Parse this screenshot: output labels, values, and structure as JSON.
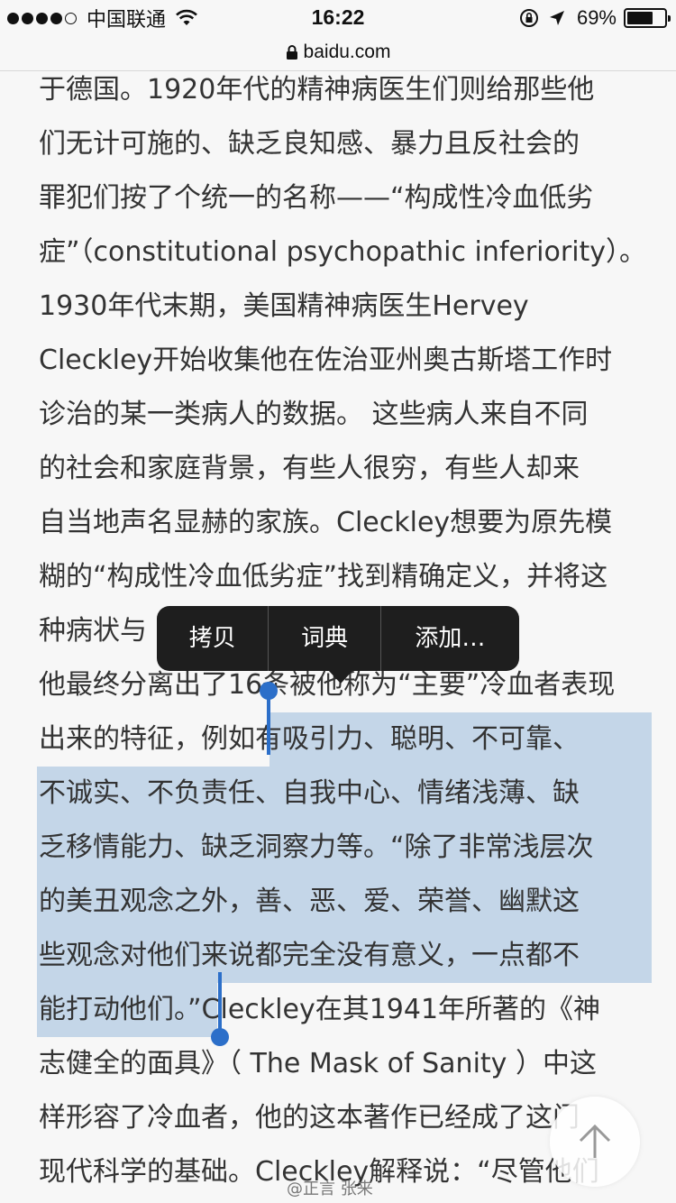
{
  "status_bar": {
    "carrier": "中国联通",
    "time": "16:22",
    "battery_percent": "69%",
    "battery_level": 0.69,
    "signal_bars_filled": 4,
    "signal_bars_total": 5,
    "icons": [
      "wifi-icon",
      "rotation-lock-icon",
      "location-arrow-icon",
      "battery-icon"
    ]
  },
  "browser": {
    "url": "baidu.com",
    "lock_icon": "lock-icon"
  },
  "article": {
    "lines": [
      "于德国。1920年代的精神病医生们则给那些他",
      "们无计可施的、缺乏良知感、暴力且反社会的",
      "罪犯们按了个统一的名称——“构成性冷血低劣",
      "症”（constitutional psychopathic inferiority）。",
      "1930年代末期，美国精神病医生Hervey",
      "Cleckley开始收集他在佐治亚州奥古斯塔工作时",
      "诊治的某一类病人的数据。 这些病人来自不同",
      "的社会和家庭背景，有些人很穷，有些人却来",
      "自当地声名显赫的家族。Cleckley想要为原先模",
      "糊的“构成性冷血低劣症”找到精确定义，并将这",
      "种病状与",
      "他最终分离出了16条被他称为“主要”冷血者表现",
      "出来的特征，例如有吸引力、聪明、不可靠、",
      "不诚实、不负责任、自我中心、情绪浅薄、缺",
      "乏移情能力、缺乏洞察力等。“除了非常浅层次",
      "的美丑观念之外，善、恶、爱、荣誉、幽默这",
      "些观念对他们来说都完全没有意义，一点都不",
      "能打动他们。”Cleckley在其1941年所著的《神",
      "志健全的面具》（ The Mask of Sanity ）中这",
      "样形容了冷血者，他的这本著作已经成了这门",
      "现代科学的基础。Cleckley解释说：“尽管他们"
    ]
  },
  "context_menu": {
    "items": [
      "拷贝",
      "词典",
      "添加…"
    ]
  },
  "scroll_top_icon": "arrow-up-icon",
  "watermark": "@正言 张来"
}
